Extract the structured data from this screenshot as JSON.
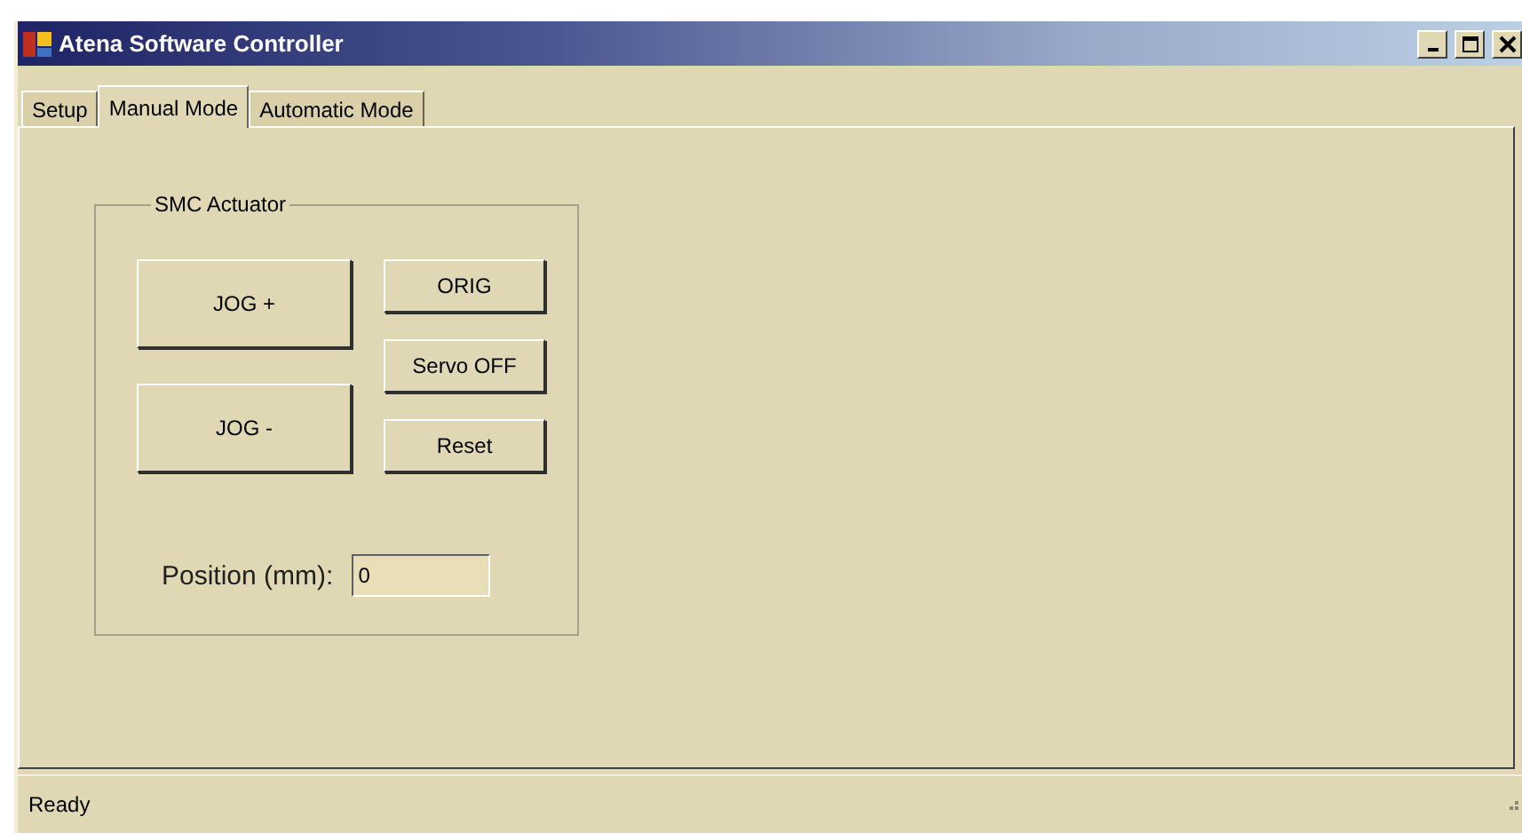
{
  "window": {
    "title": "Atena Software Controller"
  },
  "tabs": [
    {
      "label": "Setup",
      "selected": false
    },
    {
      "label": "Manual Mode",
      "selected": true
    },
    {
      "label": "Automatic Mode",
      "selected": false
    }
  ],
  "group": {
    "title": "SMC Actuator",
    "jog_buttons": [
      "JOG +",
      "JOG -"
    ],
    "side_buttons": [
      "ORIG",
      "Servo OFF",
      "Reset"
    ],
    "position": {
      "label": "Position (mm):",
      "value": "0"
    }
  },
  "status_bar": {
    "text": "Ready"
  }
}
